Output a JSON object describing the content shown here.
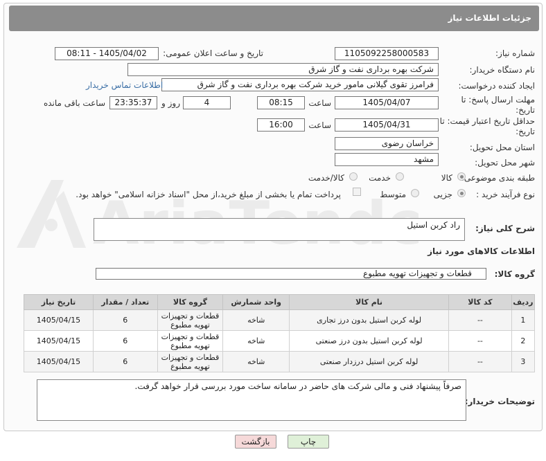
{
  "header": {
    "title": "جزئیات اطلاعات نیاز"
  },
  "form": {
    "need_number_label": "شماره نیاز:",
    "need_number": "1105092258000583",
    "announce_label": "تاریخ و ساعت اعلان عمومی:",
    "announce_value": "1405/04/02 - 08:11",
    "buyer_org_label": "نام دستگاه خریدار:",
    "buyer_org": "شرکت بهره برداری نفت و گاز شرق",
    "creator_label": "ایجاد کننده درخواست:",
    "creator": "فرامرز تقوی گیلانی مامور خرید شرکت بهره برداری نفت و گاز شرق",
    "contact_link": "اطلاعات تماس خریدار",
    "deadline_label": "مهلت ارسال پاسخ: تا تاریخ:",
    "deadline_date": "1405/04/07",
    "time_label": "ساعت",
    "deadline_time": "08:15",
    "days_value": "4",
    "days_label": "روز و",
    "remaining_time": "23:35:37",
    "remaining_label": "ساعت باقی مانده",
    "validity_label": "حداقل تاریخ اعتبار قیمت: تا تاریخ:",
    "validity_date": "1405/04/31",
    "validity_time": "16:00",
    "province_label": "استان محل تحویل:",
    "province": "خراسان رضوی",
    "city_label": "شهر محل تحویل:",
    "city": "مشهد",
    "category_label": "طبقه بندی موضوعی:",
    "category_options": [
      "کالا",
      "خدمت",
      "کالا/خدمت"
    ],
    "process_label": "نوع فرآیند خرید :",
    "process_options": [
      "جزیی",
      "متوسط"
    ],
    "payment_note": "پرداخت تمام یا بخشی از مبلغ خرید،از محل \"اسناد خزانه اسلامی\" خواهد بود."
  },
  "description": {
    "label": "شرح کلی نیاز:",
    "value": "راد کربن استیل"
  },
  "goods_section": {
    "title": "اطلاعات کالاهای مورد نیاز",
    "group_label": "گروه کالا:",
    "group_value": "قطعات و تجهیزات تهویه مطبوع"
  },
  "table": {
    "headers": [
      "ردیف",
      "کد کالا",
      "نام کالا",
      "واحد شمارش",
      "گروه کالا",
      "تعداد / مقدار",
      "تاریخ نیاز"
    ],
    "rows": [
      {
        "idx": "1",
        "code": "--",
        "name": "لوله کربن استیل بدون درز تجاری",
        "unit": "شاخه",
        "group": "قطعات و تجهیزات تهویه مطبوع",
        "qty": "6",
        "date": "1405/04/15"
      },
      {
        "idx": "2",
        "code": "--",
        "name": "لوله کربن استیل بدون درز صنعتی",
        "unit": "شاخه",
        "group": "قطعات و تجهیزات تهویه مطبوع",
        "qty": "6",
        "date": "1405/04/15"
      },
      {
        "idx": "3",
        "code": "--",
        "name": "لوله کربن استیل درزدار صنعتی",
        "unit": "شاخه",
        "group": "قطعات و تجهیزات تهویه مطبوع",
        "qty": "6",
        "date": "1405/04/15"
      }
    ]
  },
  "buyer_notes": {
    "label": "توضیحات خریدار:",
    "value": "صرفاً پیشنهاد فنی و مالی شرکت های حاضر در سامانه ساخت مورد بررسی قرار خواهد گرفت."
  },
  "buttons": {
    "print": "چاپ",
    "back": "بازگشت"
  },
  "watermark": {
    "text": "AriaTender.neT"
  },
  "colors": {
    "header_bg": "#8c8c8c",
    "link": "#3a6ea5",
    "back_btn_bg": "#f6d9d9",
    "print_btn_bg": "#dff0d8"
  }
}
